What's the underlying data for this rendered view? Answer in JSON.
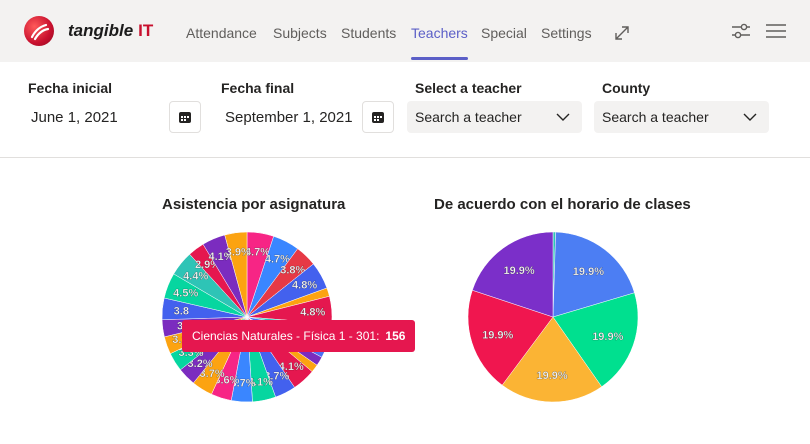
{
  "brand": {
    "name": "tangible",
    "suffix": "IT"
  },
  "nav": [
    {
      "label": "Attendance",
      "active": false
    },
    {
      "label": "Subjects",
      "active": false
    },
    {
      "label": "Students",
      "active": false
    },
    {
      "label": "Teachers",
      "active": true
    },
    {
      "label": "Special",
      "active": false
    },
    {
      "label": "Settings",
      "active": false
    }
  ],
  "icons": {
    "expand": "expand-icon",
    "filters": "sliders-icon",
    "menu": "hamburger-menu-icon",
    "calendar": "calendar-icon",
    "dropdown": "chevron-down-icon"
  },
  "filters": {
    "start_label": "Fecha inicial",
    "start_value": "June 1, 2021",
    "end_label": "Fecha final",
    "end_value": "September 1, 2021",
    "teacher_label": "Select a teacher",
    "teacher_placeholder": "Search a teacher",
    "county_label": "County",
    "county_placeholder": "Search a teacher"
  },
  "tooltip": {
    "label": "Ciencias Naturales - Física 1 - 301:",
    "value": "156"
  },
  "chart_data": [
    {
      "type": "pie",
      "title": "Asistencia por asignatura",
      "slices": [
        {
          "label": "4.7%",
          "value": 4.7,
          "color": "#f72585"
        },
        {
          "label": "4.7%",
          "value": 4.7,
          "color": "#3a86ff"
        },
        {
          "label": "3.8%",
          "value": 3.8,
          "color": "#e63946"
        },
        {
          "label": "4.8%",
          "value": 4.8,
          "color": "#4361ee"
        },
        {
          "label": "",
          "value": 1.5,
          "color": "#fca311"
        },
        {
          "label": "4.8%",
          "value": 4.8,
          "color": "#e5174f"
        },
        {
          "label": "",
          "value": 1.4,
          "color": "#2ec4b6"
        },
        {
          "label": "4.7%",
          "value": 4.7,
          "color": "#4c6ef5"
        },
        {
          "label": "",
          "value": 1.6,
          "color": "#7b2cbf"
        },
        {
          "label": "",
          "value": 1.4,
          "color": "#fca311"
        },
        {
          "label": "4.1%",
          "value": 4.1,
          "color": "#e5174f"
        },
        {
          "label": "3.7%",
          "value": 3.7,
          "color": "#4361ee"
        },
        {
          "label": "4.1%",
          "value": 4.1,
          "color": "#06d6a0"
        },
        {
          "label": "3.7%",
          "value": 3.7,
          "color": "#3a86ff"
        },
        {
          "label": "3.6%",
          "value": 3.6,
          "color": "#f72585"
        },
        {
          "label": "3.7%",
          "value": 3.7,
          "color": "#fca311"
        },
        {
          "label": "3.2%",
          "value": 3.2,
          "color": "#7b2cbf"
        },
        {
          "label": "3.3%",
          "value": 3.3,
          "color": "#06d6a0"
        },
        {
          "label": "3.1%",
          "value": 3.1,
          "color": "#fca311"
        },
        {
          "label": "3.",
          "value": 3.0,
          "color": "#7b2cbf"
        },
        {
          "label": "3.8",
          "value": 3.8,
          "color": "#4361ee"
        },
        {
          "label": "4.5%",
          "value": 4.5,
          "color": "#06d6a0"
        },
        {
          "label": "4.4%",
          "value": 4.4,
          "color": "#2ec4b6"
        },
        {
          "label": "2.9%",
          "value": 2.9,
          "color": "#e5174f"
        },
        {
          "label": "4.1%",
          "value": 4.1,
          "color": "#7b2cbf"
        },
        {
          "label": "3.9%",
          "value": 3.9,
          "color": "#fca311"
        }
      ]
    },
    {
      "type": "pie",
      "title": "De acuerdo con el horario de clases",
      "slices": [
        {
          "label": "",
          "value": 0.5,
          "color": "#2ec4b6"
        },
        {
          "label": "19.9%",
          "value": 19.9,
          "color": "#4c7ef3"
        },
        {
          "label": "19.9%",
          "value": 19.9,
          "color": "#00e08f"
        },
        {
          "label": "19.9%",
          "value": 19.9,
          "color": "#fbb434"
        },
        {
          "label": "19.9%",
          "value": 19.9,
          "color": "#f0164f"
        },
        {
          "label": "19.9%",
          "value": 19.9,
          "color": "#7b2fc9"
        }
      ]
    }
  ]
}
